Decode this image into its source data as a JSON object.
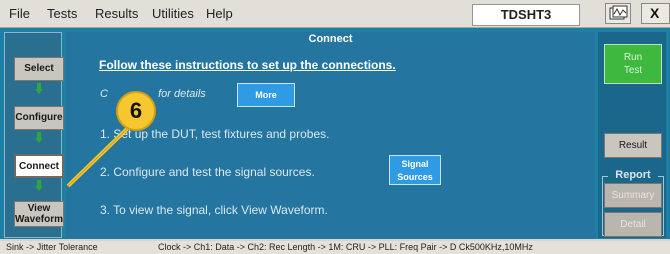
{
  "menubar": {
    "items": [
      "File",
      "Tests",
      "Results",
      "Utilities",
      "Help"
    ],
    "app_name": "TDSHT3",
    "close_label": "X"
  },
  "left_nav": {
    "select": "Select",
    "configure": "Configure",
    "connect": "Connect",
    "view_waveform_line1": "View",
    "view_waveform_line2": "Waveform"
  },
  "content": {
    "title": "Connect",
    "instruction_header": "Follow these instructions to set up the connections.",
    "details_prefix": "C",
    "details_suffix": "for details",
    "more_button": "More",
    "steps": [
      "1. Set up the DUT, test fixtures and probes.",
      "2. Configure and test the signal sources.",
      "3. To view the signal, click View Waveform."
    ],
    "signal_sources_line1": "Signal",
    "signal_sources_line2": "Sources"
  },
  "right_panel": {
    "run_line1": "Run",
    "run_line2": "Test",
    "result": "Result",
    "report_label": "Report",
    "summary": "Summary",
    "detail": "Detail"
  },
  "callout": {
    "number": "6"
  },
  "statusbar": {
    "left": "Sink -> Jitter Tolerance",
    "right": "Clock -> Ch1: Data -> Ch2: Rec Length -> 1M: CRU -> PLL: Freq Pair -> D Ck500KHz,10MHz"
  },
  "colors": {
    "panel": "#1e7fa5",
    "content": "#2476a0",
    "button_blue": "#2f9be4",
    "run_green": "#3fb83f",
    "callout": "#f6c72e"
  }
}
